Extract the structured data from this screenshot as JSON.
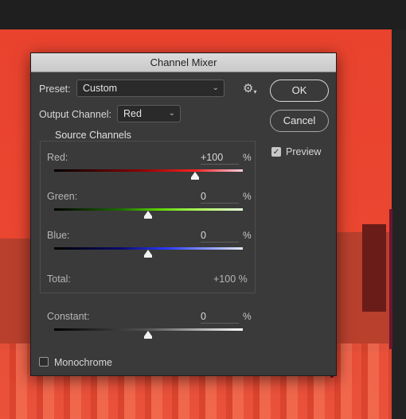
{
  "dialog": {
    "title": "Channel Mixer"
  },
  "preset": {
    "label": "Preset:",
    "value": "Custom"
  },
  "output_channel": {
    "label": "Output Channel:",
    "value": "Red"
  },
  "buttons": {
    "ok": "OK",
    "cancel": "Cancel"
  },
  "preview": {
    "label": "Preview",
    "checked": true
  },
  "source_channels": {
    "title": "Source Channels",
    "red": {
      "label": "Red:",
      "value": "+100",
      "unit": "%",
      "level": 0.75
    },
    "green": {
      "label": "Green:",
      "value": "0",
      "unit": "%",
      "level": 0.5
    },
    "blue": {
      "label": "Blue:",
      "value": "0",
      "unit": "%",
      "level": 0.5
    },
    "total": {
      "label": "Total:",
      "value": "+100 %"
    }
  },
  "constant": {
    "label": "Constant:",
    "value": "0",
    "unit": "%",
    "level": 0.5
  },
  "monochrome": {
    "label": "Monochrome",
    "checked": false
  },
  "icons": {
    "settings": "gear-icon",
    "chevron": "chevron-down-icon",
    "check": "checkmark-icon"
  },
  "colors": {
    "canvas_red": "#e9432e",
    "dialog_bg": "#3a3a3a",
    "titlebar": "#d2d2d2"
  }
}
